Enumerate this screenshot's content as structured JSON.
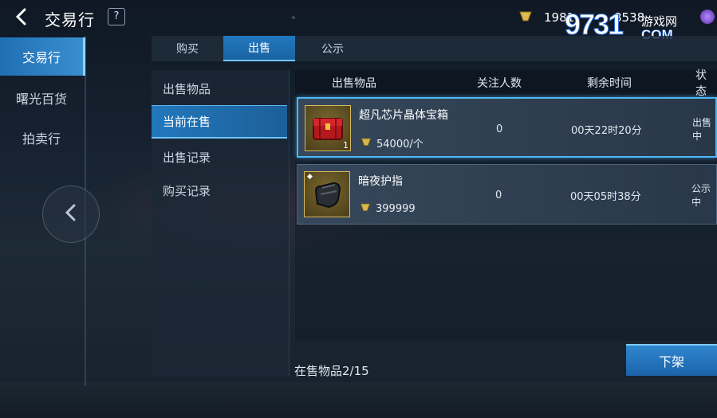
{
  "header": {
    "title": "交易行",
    "help_label": "?",
    "dot": "。",
    "currency_gold": "1981",
    "currency_crystal": "8538"
  },
  "watermark": {
    "number": "9731",
    "text_zh": "游戏网",
    "text_com": "COM"
  },
  "left_nav": {
    "items": [
      {
        "label": "交易行",
        "active": true
      },
      {
        "label": "曙光百货",
        "active": false
      },
      {
        "label": "拍卖行",
        "active": false
      }
    ]
  },
  "tabs": [
    {
      "label": "购买",
      "active": false
    },
    {
      "label": "出售",
      "active": true
    },
    {
      "label": "公示",
      "active": false
    }
  ],
  "submenu": [
    {
      "label": "出售物品",
      "active": false
    },
    {
      "label": "当前在售",
      "active": true
    },
    {
      "label": "出售记录",
      "active": false
    },
    {
      "label": "购买记录",
      "active": false
    }
  ],
  "table": {
    "columns": [
      "出售物品",
      "关注人数",
      "剩余时间",
      "状态"
    ],
    "rows": [
      {
        "name": "超凡芯片晶体宝箱",
        "price": "54000/个",
        "qty": "1",
        "followers": "0",
        "time_left": "00天22时20分",
        "status": "出售中",
        "icon": "red-chest-icon"
      },
      {
        "name": "暗夜护指",
        "price": "399999",
        "qty": "",
        "followers": "0",
        "time_left": "00天05时38分",
        "status": "公示中",
        "icon": "dark-glove-icon"
      }
    ]
  },
  "footer": {
    "count_text": "在售物品2/15",
    "delist_label": "下架"
  },
  "colors": {
    "accent": "#2279c0",
    "highlight": "#4fb8f5",
    "gold_border": "#d8b860"
  }
}
